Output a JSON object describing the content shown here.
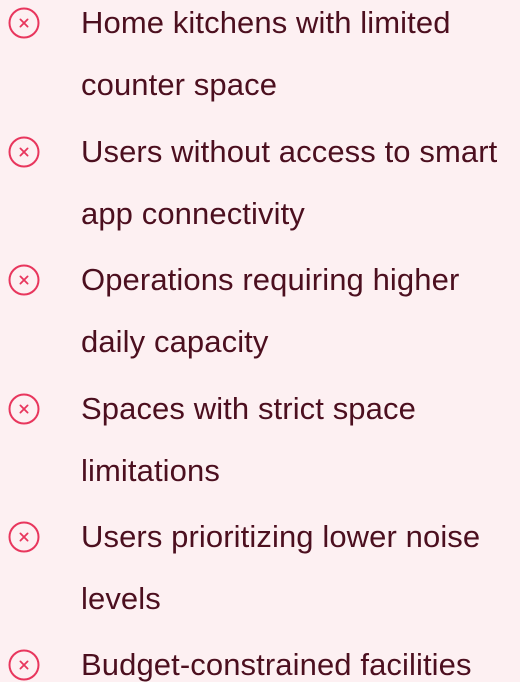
{
  "accent_color": "#e8365d",
  "text_color": "#4c0f1f",
  "background_color": "#fdf0f2",
  "items": [
    {
      "icon": "close-circle-icon",
      "label": "Home kitchens with limited counter space"
    },
    {
      "icon": "close-circle-icon",
      "label": "Users without access to smart app connectivity"
    },
    {
      "icon": "close-circle-icon",
      "label": "Operations requiring higher daily capacity"
    },
    {
      "icon": "close-circle-icon",
      "label": "Spaces with strict space limitations"
    },
    {
      "icon": "close-circle-icon",
      "label": "Users prioritizing lower noise levels"
    },
    {
      "icon": "close-circle-icon",
      "label": "Budget-constrained facilities"
    }
  ]
}
